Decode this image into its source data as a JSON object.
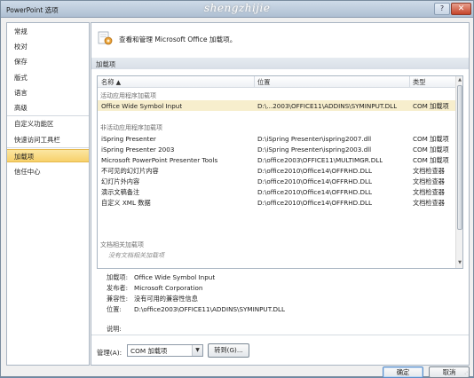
{
  "window": {
    "title": "PowerPoint 选项",
    "watermark": "shengzhijie",
    "help_glyph": "?",
    "close_glyph": "✕"
  },
  "sidebar": {
    "items": [
      {
        "label": "常规"
      },
      {
        "label": "校对"
      },
      {
        "label": "保存"
      },
      {
        "label": "版式"
      },
      {
        "label": "语言"
      },
      {
        "label": "高级"
      },
      {
        "label": "自定义功能区"
      },
      {
        "label": "快速访问工具栏"
      },
      {
        "label": "加载项"
      },
      {
        "label": "信任中心"
      }
    ],
    "active_index": 8
  },
  "header": {
    "text": "查看和管理 Microsoft Office 加载项。"
  },
  "section": {
    "title": "加载项"
  },
  "table": {
    "columns": [
      "名称 ▲",
      "位置",
      "类型"
    ],
    "groups": {
      "active": "活动应用程序加载项",
      "inactive": "非活动应用程序加载项",
      "document": "文档相关加载项",
      "document_empty": "没有文档相关加载项"
    },
    "active_rows": [
      {
        "name": "Office Wide Symbol Input",
        "location": "D:\\...2003\\OFFICE11\\ADDINS\\SYMINPUT.DLL",
        "type": "COM 加载项"
      }
    ],
    "inactive_rows": [
      {
        "name": "iSpring Presenter",
        "location": "D:\\iSpring Presenter\\ispring2007.dll",
        "type": "COM 加载项"
      },
      {
        "name": "iSpring Presenter 2003",
        "location": "D:\\iSpring Presenter\\ispring2003.dll",
        "type": "COM 加载项"
      },
      {
        "name": "Microsoft PowerPoint Presenter Tools",
        "location": "D:\\office2003\\OFFICE11\\MULTIMGR.DLL",
        "type": "COM 加载项"
      },
      {
        "name": "不可见的幻灯片内容",
        "location": "D:\\office2010\\Office14\\OFFRHD.DLL",
        "type": "文档检查器"
      },
      {
        "name": "幻灯片外内容",
        "location": "D:\\office2010\\Office14\\OFFRHD.DLL",
        "type": "文档检查器"
      },
      {
        "name": "演示文稿备注",
        "location": "D:\\office2010\\Office14\\OFFRHD.DLL",
        "type": "文档检查器"
      },
      {
        "name": "自定义 XML 数据",
        "location": "D:\\office2010\\Office14\\OFFRHD.DLL",
        "type": "文档检查器"
      }
    ],
    "scroll_up": "▲",
    "scroll_down": "▼"
  },
  "details": {
    "addin_label": "加载项:",
    "addin_value": "Office Wide Symbol Input",
    "publisher_label": "发布者:",
    "publisher_value": "Microsoft Corporation",
    "compat_label": "兼容性:",
    "compat_value": "没有可用的兼容性信息",
    "location_label": "位置:",
    "location_value": "D:\\office2003\\OFFICE11\\ADDINS\\SYMINPUT.DLL",
    "desc_label": "说明:"
  },
  "manage": {
    "label": "管理(A):",
    "selected": "COM 加载项",
    "dropdown_glyph": "▼",
    "goto_label": "转到(G)..."
  },
  "footer": {
    "ok_label": "确定",
    "cancel_label": "取消",
    "grip_glyph": "⋰"
  }
}
